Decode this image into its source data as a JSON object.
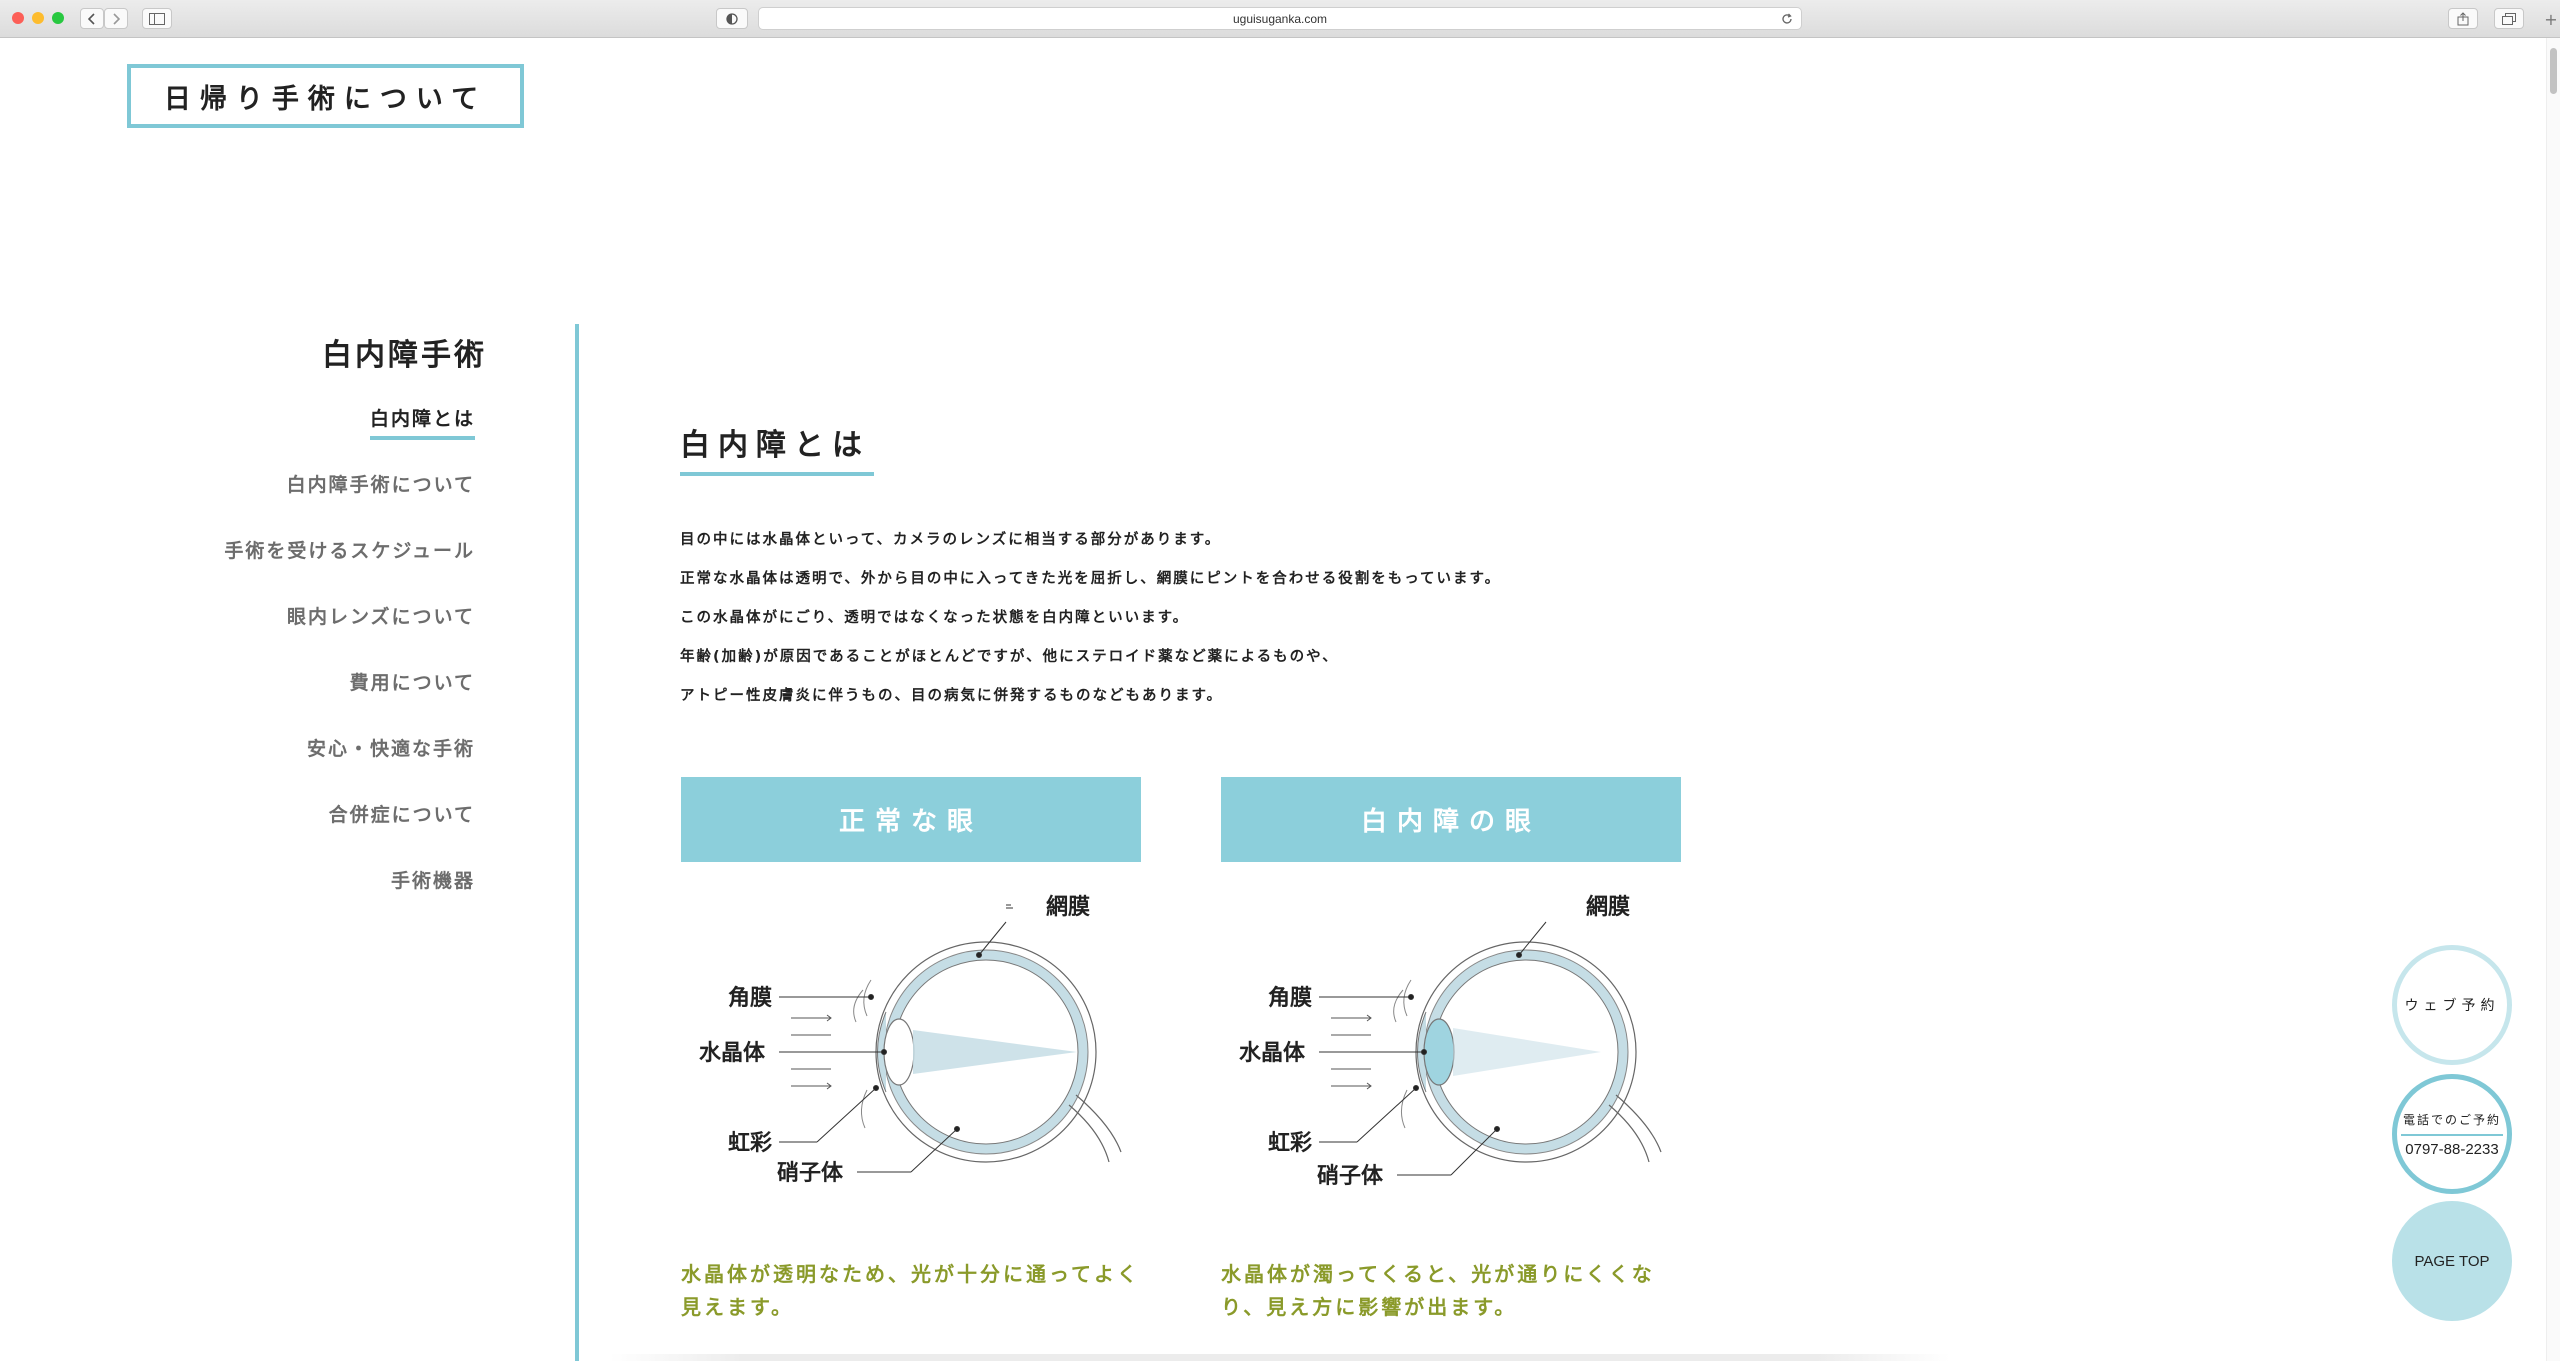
{
  "browser": {
    "url": "uguisuganka.com"
  },
  "page_badge": "日帰り手術について",
  "sidebar": {
    "title": "白内障手術",
    "items": [
      {
        "label": "白内障とは",
        "active": true
      },
      {
        "label": "白内障手術について",
        "active": false
      },
      {
        "label": "手術を受けるスケジュール",
        "active": false
      },
      {
        "label": "眼内レンズについて",
        "active": false
      },
      {
        "label": "費用について",
        "active": false
      },
      {
        "label": "安心・快適な手術",
        "active": false
      },
      {
        "label": "合併症について",
        "active": false
      },
      {
        "label": "手術機器",
        "active": false
      }
    ]
  },
  "main": {
    "title": "白内障とは",
    "paragraph": [
      "目の中には水晶体といって、カメラのレンズに相当する部分があります。",
      "正常な水晶体は透明で、外から目の中に入ってきた光を屈折し、網膜にピントを合わせる役割をもっています。",
      "この水晶体がにごり、透明ではなくなった状態を白内障といいます。",
      "年齢(加齢)が原因であることがほとんどですが、他にステロイド薬など薬によるものや、",
      "アトピー性皮膚炎に伴うもの、目の病気に併発するものなどもあります。"
    ],
    "normal_eye": {
      "heading": "正常な眼",
      "labels": {
        "retina": "網膜",
        "cornea": "角膜",
        "lens": "水晶体",
        "iris": "虹彩",
        "vitreous": "硝子体"
      },
      "caption": "水晶体が透明なため、光が十分に通ってよく見えます。"
    },
    "cataract_eye": {
      "heading": "白内障の眼",
      "labels": {
        "retina": "網膜",
        "cornea": "角膜",
        "lens": "水晶体",
        "iris": "虹彩",
        "vitreous": "硝子体"
      },
      "caption": "水晶体が濁ってくると、光が通りにくくなり、見え方に影響が出ます。"
    }
  },
  "floating": {
    "web_reserve": "ウェブ予約",
    "tel_label": "電話でのご予約",
    "tel_number": "0797-88-2233",
    "page_top": "PAGE TOP"
  },
  "colors": {
    "accent": "#7fc8d6",
    "heading_box": "#8ccfdb",
    "caption_text": "#8a9a2a",
    "eye_fill": "#c5dde5"
  }
}
